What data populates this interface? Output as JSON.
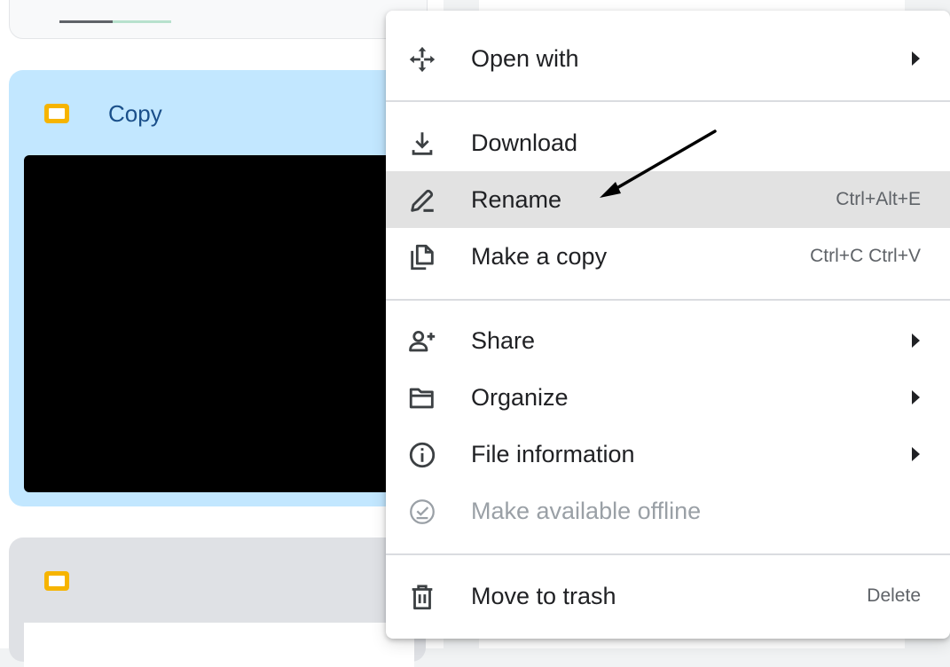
{
  "files": {
    "selected_title": "Copy"
  },
  "context_menu": {
    "open_with": "Open with",
    "download": "Download",
    "rename": "Rename",
    "rename_shortcut": "Ctrl+Alt+E",
    "make_copy": "Make a copy",
    "make_copy_shortcut": "Ctrl+C Ctrl+V",
    "share": "Share",
    "organize": "Organize",
    "file_information": "File information",
    "make_offline": "Make available offline",
    "move_to_trash": "Move to trash",
    "trash_shortcut": "Delete"
  },
  "icons": {
    "open_with": "move-arrows-icon",
    "download": "download-icon",
    "rename": "pencil-icon",
    "make_copy": "copy-icon",
    "share": "person-add-icon",
    "organize": "folder-open-icon",
    "file_information": "info-icon",
    "make_offline": "offline-check-icon",
    "move_to_trash": "trash-icon"
  },
  "colors": {
    "selected_card": "#c2e7ff",
    "slides_icon": "#f6b400",
    "highlight_row": "#e2e2e2"
  }
}
